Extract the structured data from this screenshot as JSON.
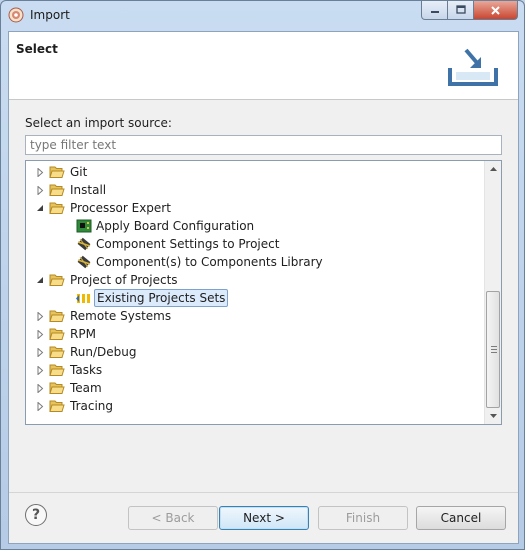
{
  "window": {
    "title": "Import"
  },
  "header": {
    "title": "Select"
  },
  "source": {
    "label": "Select an import source:",
    "filter_placeholder": "type filter text",
    "filter_value": ""
  },
  "tree": {
    "items": [
      {
        "label": "Git",
        "level": 0,
        "type": "folder",
        "expanded": false
      },
      {
        "label": "Install",
        "level": 0,
        "type": "folder",
        "expanded": false
      },
      {
        "label": "Processor Expert",
        "level": 0,
        "type": "folder",
        "expanded": true
      },
      {
        "label": "Apply Board Configuration",
        "level": 1,
        "type": "board-icon"
      },
      {
        "label": "Component Settings to Project",
        "level": 1,
        "type": "component-icon"
      },
      {
        "label": "Component(s) to Components Library",
        "level": 1,
        "type": "component-icon"
      },
      {
        "label": "Project of Projects",
        "level": 0,
        "type": "folder",
        "expanded": true
      },
      {
        "label": "Existing Projects Sets",
        "level": 1,
        "type": "project-set-icon",
        "selected": true
      },
      {
        "label": "Remote Systems",
        "level": 0,
        "type": "folder",
        "expanded": false
      },
      {
        "label": "RPM",
        "level": 0,
        "type": "folder",
        "expanded": false
      },
      {
        "label": "Run/Debug",
        "level": 0,
        "type": "folder",
        "expanded": false
      },
      {
        "label": "Tasks",
        "level": 0,
        "type": "folder",
        "expanded": false
      },
      {
        "label": "Team",
        "level": 0,
        "type": "folder",
        "expanded": false
      },
      {
        "label": "Tracing",
        "level": 0,
        "type": "folder",
        "expanded": false
      }
    ]
  },
  "buttons": {
    "help": "?",
    "back": "< Back",
    "next": "Next >",
    "finish": "Finish",
    "cancel": "Cancel"
  },
  "colors": {
    "selection_bg": "#dcebfc",
    "selection_border": "#7da2ce",
    "folder": "#e8c25a",
    "default_button_border": "#3c7fb1"
  }
}
